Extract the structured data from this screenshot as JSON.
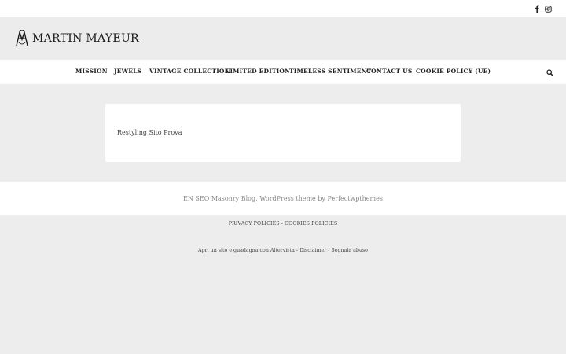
{
  "topbar": {
    "social": [
      {
        "icon": "facebook-icon",
        "glyph": "f"
      },
      {
        "icon": "instagram-icon"
      }
    ]
  },
  "header": {
    "logo_text": "Martin Mayeur"
  },
  "nav": {
    "items": [
      {
        "label": "MISSION"
      },
      {
        "label": "JEWELS"
      },
      {
        "label": "VINTAGE COLLECTION"
      },
      {
        "label": "LIMITED EDITION"
      },
      {
        "label": "TIMELESS SENTIMENT"
      },
      {
        "label": "CONTACT US"
      },
      {
        "label": "COOKIE POLICY (UE)"
      }
    ],
    "search_icon": "search-icon"
  },
  "main": {
    "post_title": "Restyling Sito Prova"
  },
  "footer": {
    "credit": "EN SEO Masonry Blog, WordPress theme by Perfectwpthemes",
    "privacy_link": "PRIVACY POLICIES",
    "sep1": " - ",
    "cookies_link": "COOKIES POLICIES",
    "altervista_text": "Apri un sito e guadagna con Altervista",
    "sep2": " - ",
    "disclaimer_link": "Disclaimer",
    "sep3": " - ",
    "report_link": "Segnala abuso"
  },
  "colors": {
    "page_bg": "#ededed",
    "bar_bg": "#ffffff",
    "text": "#222222"
  }
}
